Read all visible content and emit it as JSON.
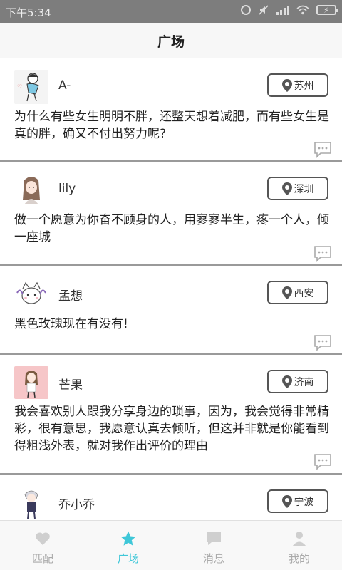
{
  "status_bar": {
    "time": "下午5:34",
    "icons": [
      "alarm-icon",
      "mute-icon",
      "signal-icon",
      "wifi-icon",
      "battery-charging-icon"
    ]
  },
  "header": {
    "title": "广场"
  },
  "posts": [
    {
      "username": "A-",
      "location": "苏州",
      "content": "为什么有些女生明明不胖，还整天想着减肥，而有些女生是真的胖，确又不付出努力呢?"
    },
    {
      "username": "lily",
      "location": "深圳",
      "content": "做一个愿意为你奋不顾身的人，用寥寥半生，疼一个人，倾一座城"
    },
    {
      "username": "孟想",
      "location": "西安",
      "content": "黑色玫瑰现在有没有!"
    },
    {
      "username": "芒果",
      "location": "济南",
      "content": "我会喜欢别人跟我分享身边的琐事，因为，我会觉得非常精彩，很有意思，我愿意认真去倾听，但这并非就是你能看到得粗浅外表，就对我作出评价的理由"
    },
    {
      "username": "乔小乔",
      "location": "宁波",
      "content": ""
    }
  ],
  "tabs": [
    {
      "label": "匹配",
      "icon": "heart-icon"
    },
    {
      "label": "广场",
      "icon": "star-icon"
    },
    {
      "label": "消息",
      "icon": "message-icon"
    },
    {
      "label": "我的",
      "icon": "user-icon"
    }
  ],
  "active_tab": "广场",
  "colors": {
    "accent": "#3fc7d8",
    "status_bar": "#7d7d7d",
    "inactive_tab": "#aaaaaa"
  }
}
